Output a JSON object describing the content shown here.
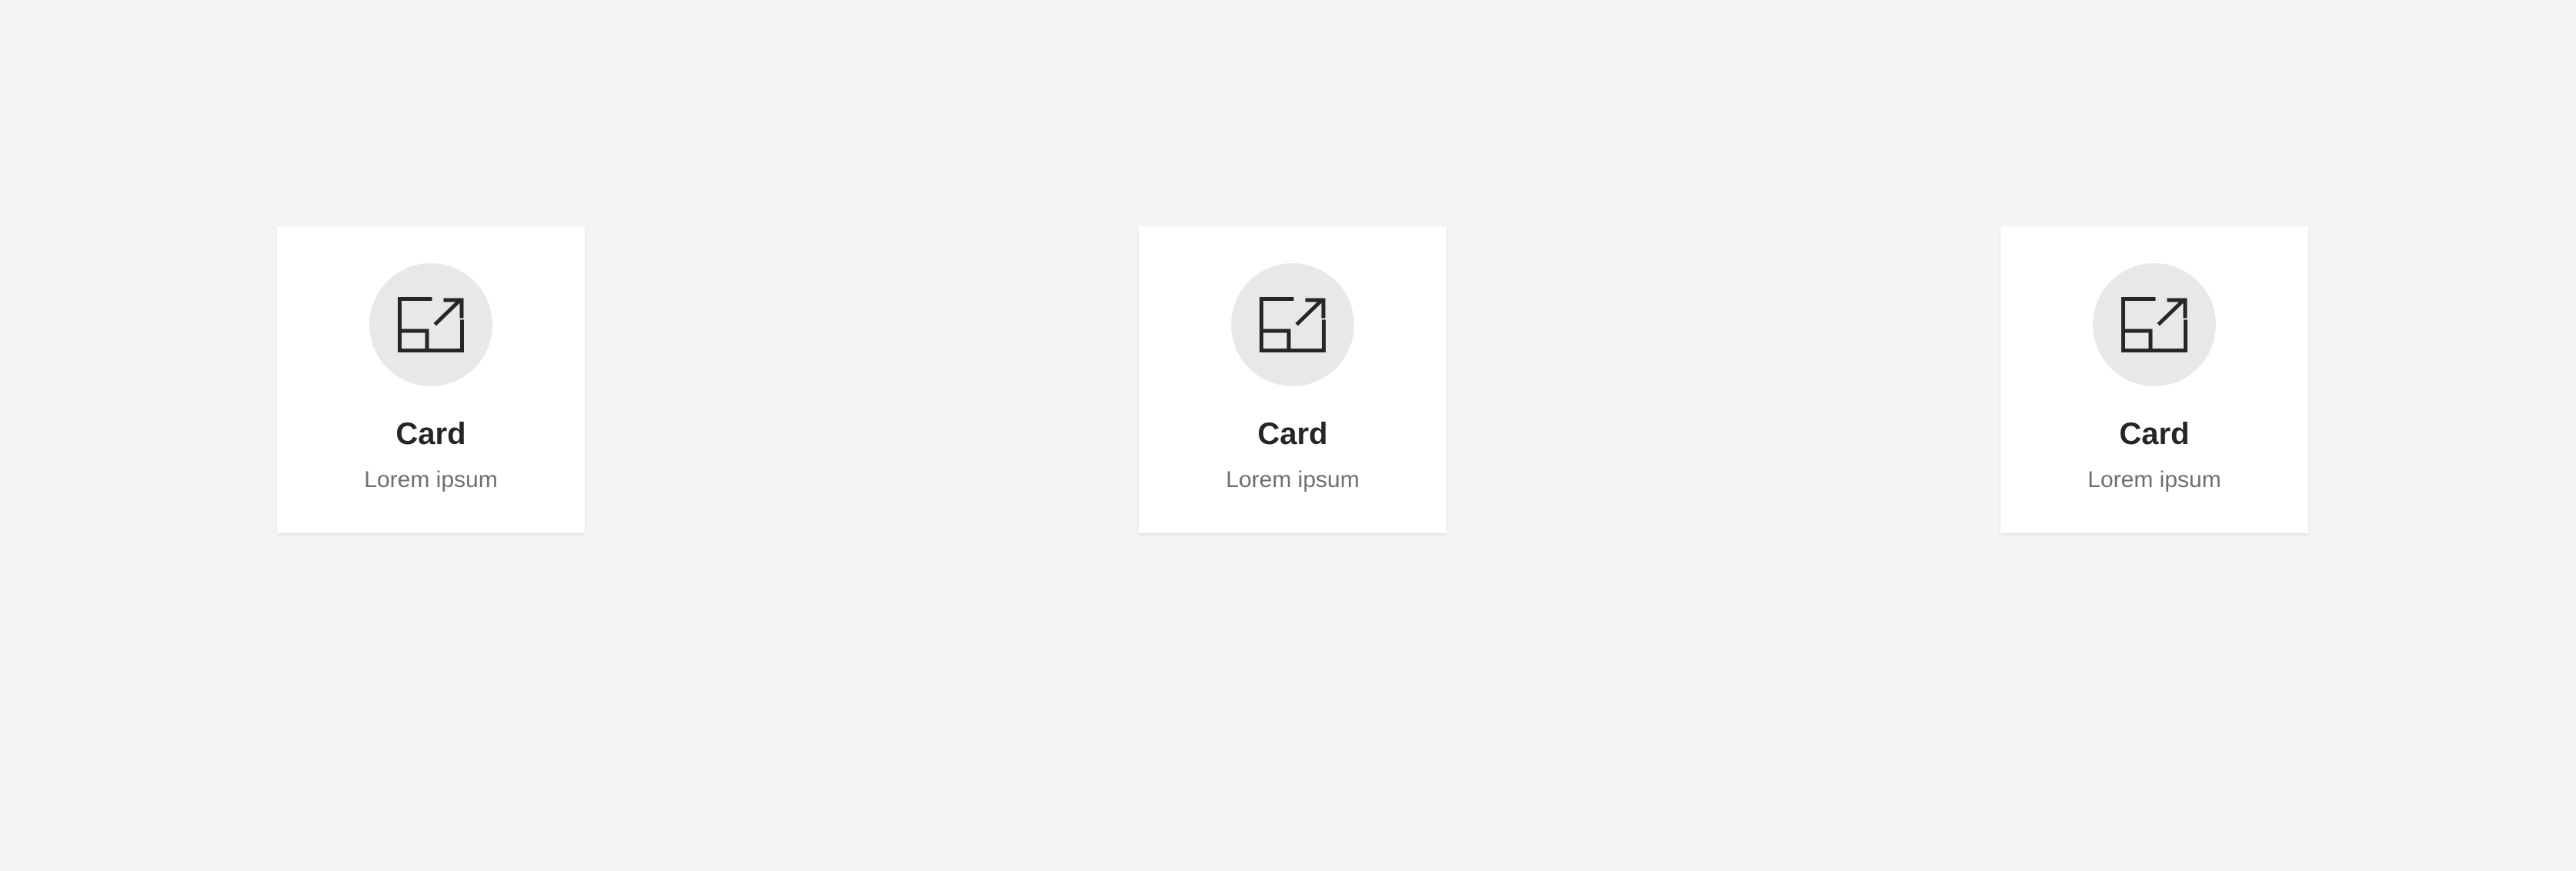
{
  "colors": {
    "background": "#f4f4f4",
    "card": "#ffffff",
    "icon_circle": "#e8e8e8",
    "icon_stroke": "#262626",
    "title": "#262626",
    "description": "#6f6f6f"
  },
  "cards": [
    {
      "icon": "launch-icon",
      "title": "Card",
      "description": "Lorem ipsum"
    },
    {
      "icon": "launch-icon",
      "title": "Card",
      "description": "Lorem ipsum"
    },
    {
      "icon": "launch-icon",
      "title": "Card",
      "description": "Lorem ipsum"
    }
  ]
}
